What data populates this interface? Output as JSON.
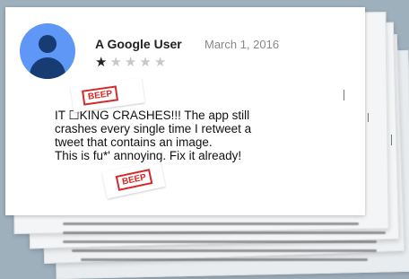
{
  "review": {
    "author": "A Google User",
    "date": "March 1, 2016",
    "rating": 1,
    "max_rating": 5,
    "text_lines": [
      "IT   ☐KING CRASHES!!! The app still",
      "crashes every single time I retweet a",
      "tweet that contains an image.",
      "This is fu*'   annoying. Fix it already!"
    ]
  },
  "censor": {
    "label_1": "BEEP",
    "label_2": "BEEP",
    "color": "#d62828"
  },
  "colors": {
    "avatar": "#5e97f6",
    "avatar_figure": "#173b73",
    "background": "#9fb0bd"
  },
  "icons": {
    "avatar": "person-avatar-icon",
    "star": "star-icon"
  }
}
